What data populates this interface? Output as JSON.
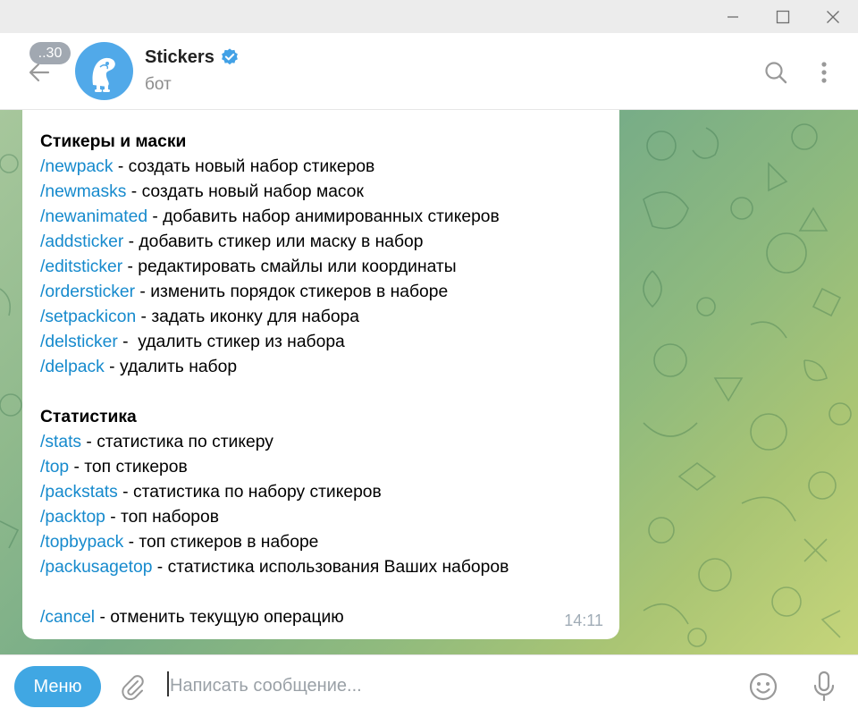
{
  "window": {
    "controls": [
      "minimize-icon",
      "maximize-icon",
      "close-icon"
    ]
  },
  "header": {
    "back_badge": "..30",
    "title": "Stickers",
    "subtitle": "бот",
    "verified": true,
    "icons": [
      "search-icon",
      "more-vertical-icon"
    ]
  },
  "message": {
    "time": "14:11",
    "sections": [
      {
        "heading": "Стикеры и маски",
        "items": [
          {
            "cmd": "/newpack",
            "desc": " - создать новый набор стикеров"
          },
          {
            "cmd": "/newmasks",
            "desc": " - создать новый набор масок"
          },
          {
            "cmd": "/newanimated",
            "desc": " - добавить набор анимированных стикеров"
          },
          {
            "cmd": "/addsticker",
            "desc": " - добавить стикер или маску в набор"
          },
          {
            "cmd": "/editsticker",
            "desc": " - редактировать смайлы или координаты"
          },
          {
            "cmd": "/ordersticker",
            "desc": " - изменить порядок стикеров в наборе"
          },
          {
            "cmd": "/setpackicon",
            "desc": " - задать иконку для набора"
          },
          {
            "cmd": "/delsticker",
            "desc": " -  удалить стикер из набора"
          },
          {
            "cmd": "/delpack",
            "desc": " - удалить набор"
          }
        ]
      },
      {
        "heading": "Статистика",
        "items": [
          {
            "cmd": "/stats",
            "desc": " - статистика по стикеру"
          },
          {
            "cmd": "/top",
            "desc": " - топ стикеров"
          },
          {
            "cmd": "/packstats",
            "desc": " - статистика по набору стикеров"
          },
          {
            "cmd": "/packtop",
            "desc": " - топ наборов"
          },
          {
            "cmd": "/topbypack",
            "desc": " - топ стикеров в наборе"
          },
          {
            "cmd": "/packusagetop",
            "desc": " - статистика использования Ваших наборов"
          }
        ]
      },
      {
        "heading": "",
        "items": [
          {
            "cmd": "/cancel",
            "desc": " - отменить текущую операцию"
          }
        ]
      }
    ]
  },
  "composer": {
    "menu_label": "Меню",
    "placeholder": "Написать сообщение...",
    "icons": [
      "attach-icon",
      "emoji-icon",
      "microphone-icon"
    ]
  },
  "colors": {
    "accent": "#40a7e3",
    "link": "#168acd",
    "avatar": "#51a9e9",
    "badge": "#a1a8b1"
  }
}
